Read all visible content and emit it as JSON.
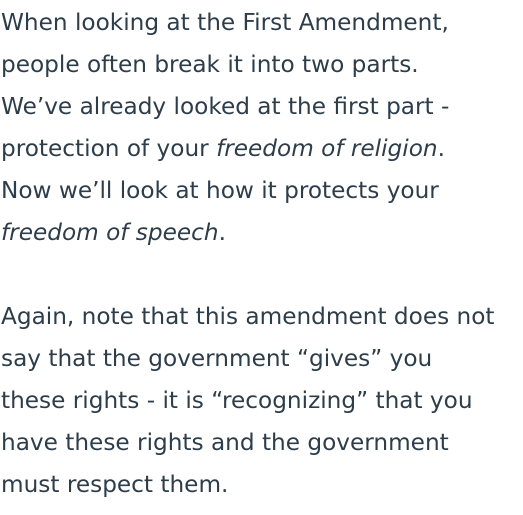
{
  "paragraph1": {
    "line1": "When looking at the First Amendment,",
    "line2": "people often break it into two parts.",
    "line3": "We’ve already looked at the first part -",
    "line4_pre": "protection of your ",
    "line4_em": "freedom of religion",
    "line4_post": ".",
    "line5": "Now we’ll look at how it protects your",
    "line6_em": "freedom of speech",
    "line6_post": "."
  },
  "paragraph2": {
    "line1": "Again, note that this amendment does not",
    "line2": "say that the government “gives” you",
    "line3": "these rights - it is “recognizing” that you",
    "line4": "have these rights and the government",
    "line5": "must respect them."
  }
}
